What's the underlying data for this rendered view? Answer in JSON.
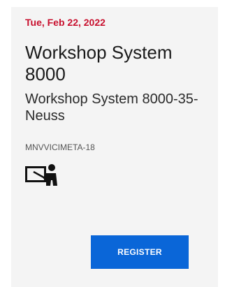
{
  "event": {
    "date": "Tue, Feb 22, 2022",
    "title": "Workshop System 8000",
    "subtitle": "Workshop System 8000-35-Neuss",
    "code": "MNVVICIMETA-18",
    "type_icon": "presenter-board-icon"
  },
  "actions": {
    "register_label": "REGISTER"
  },
  "colors": {
    "date_text": "#c8102e",
    "button_bg": "#0a66d8",
    "card_bg": "#f4f4f4"
  }
}
